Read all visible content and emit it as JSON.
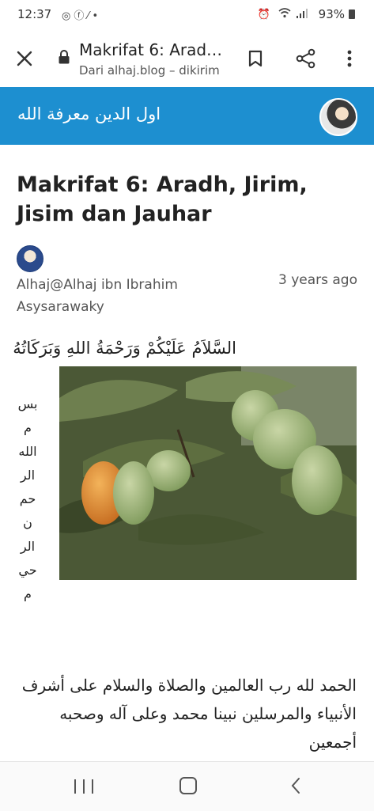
{
  "status_bar": {
    "time": "12:37",
    "left_icons": [
      "whatsapp-icon",
      "facebook-icon",
      "magic-wand-icon",
      "dot-icon"
    ],
    "right_icons": [
      "alarm-icon",
      "wifi-icon",
      "signal-icon"
    ],
    "battery": "93%"
  },
  "tab_bar": {
    "title": "Makrifat 6: Arad…",
    "subtitle": "Dari alhaj.blog – dikirim"
  },
  "site_header": {
    "title": "اول الدين معرفة الله"
  },
  "article": {
    "title": "Makrifat 6: Aradh, Jirim, Jisim dan Jauhar",
    "author": "Alhaj@Alhaj ibn Ibrahim Asysarawaky",
    "date": "3 years ago",
    "salam": "السَّلاَمُ عَلَيْكُمْ وَرَحْمَةُ اللهِ وَبَرَكَاتُهُ",
    "basmala_lines": [
      "بس",
      "م",
      "الله",
      "الر",
      "حم",
      "ن",
      "الر",
      "حي",
      "م"
    ],
    "body": "الحمد لله رب العالمين والصلاة والسلام على أشرف الأنبياء والمرسلين نبينا محمد وعلى آله وصحبه أجمعين"
  },
  "colors": {
    "header_blue": "#1d8fd0",
    "text_dark": "#222222",
    "text_muted": "#555555"
  },
  "nav_bar": {
    "icons": [
      "recent-apps-icon",
      "home-icon",
      "back-icon"
    ]
  }
}
